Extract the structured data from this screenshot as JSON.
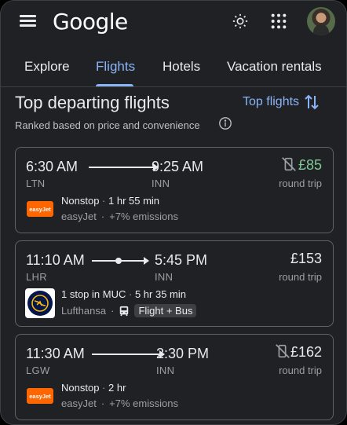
{
  "header": {
    "logo": "Google",
    "menu_icon": "menu-icon",
    "theme_icon": "brightness-icon",
    "apps_icon": "apps-grid-icon",
    "avatar_icon": "user-avatar"
  },
  "tabs": [
    {
      "label": "Explore",
      "active": false
    },
    {
      "label": "Flights",
      "active": true
    },
    {
      "label": "Hotels",
      "active": false
    },
    {
      "label": "Vacation rentals",
      "active": false
    }
  ],
  "section": {
    "title": "Top departing flights",
    "sort_label": "Top flights",
    "subtitle": "Ranked based on price and convenience"
  },
  "flights": [
    {
      "depart_time": "6:30 AM",
      "arrive_time": "9:25 AM",
      "depart_code": "LTN",
      "arrive_code": "INN",
      "price": "£85",
      "price_note": "round trip",
      "stops": "Nonstop",
      "duration": "1 hr 55 min",
      "airline": "easyJet",
      "emissions": "+7% emissions",
      "airline_logo_text": "easyJet",
      "no_wifi": true,
      "price_highlight": true
    },
    {
      "depart_time": "11:10 AM",
      "arrive_time": "5:45 PM",
      "depart_code": "LHR",
      "arrive_code": "INN",
      "price": "£153",
      "price_note": "round trip",
      "stops": "1 stop in MUC",
      "duration": "5 hr 35 min",
      "airline": "Lufthansa",
      "transfer": "Flight + Bus",
      "no_wifi": false,
      "price_highlight": false
    },
    {
      "depart_time": "11:30 AM",
      "arrive_time": "2:30 PM",
      "depart_code": "LGW",
      "arrive_code": "INN",
      "price": "£162",
      "price_note": "round trip",
      "stops": "Nonstop",
      "duration": "2 hr",
      "airline": "easyJet",
      "emissions": "+7% emissions",
      "airline_logo_text": "easyJet",
      "no_wifi": true,
      "price_highlight": false
    }
  ],
  "colors": {
    "background": "#202124",
    "accent": "#8ab4f8",
    "price_green": "#81c995",
    "text": "#e8eaed",
    "muted": "#9aa0a6"
  }
}
